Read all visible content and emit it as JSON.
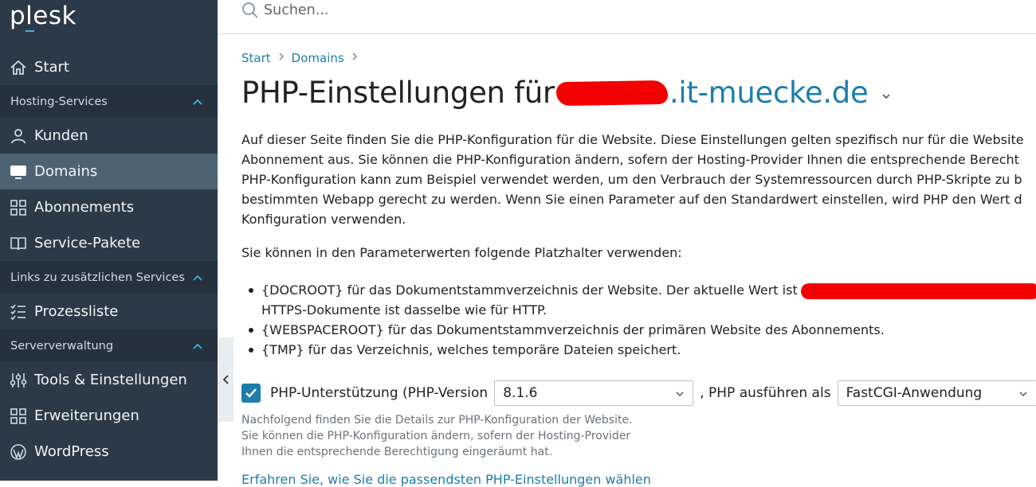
{
  "app": {
    "logo": "plesk"
  },
  "search": {
    "placeholder": "Suchen..."
  },
  "sidebar": {
    "start": "Start",
    "section_hosting": "Hosting-Services",
    "kunden": "Kunden",
    "domains": "Domains",
    "abonnements": "Abonnements",
    "service_pakete": "Service-Pakete",
    "section_links": "Links zu zusätzlichen Services",
    "prozessliste": "Prozessliste",
    "section_server": "Serververwaltung",
    "tools": "Tools & Einstellungen",
    "erweiterungen": "Erweiterungen",
    "wordpress": "WordPress"
  },
  "breadcrumb": {
    "start": "Start",
    "domains": "Domains"
  },
  "page": {
    "title_prefix": "PHP-Einstellungen für",
    "title_domain": ".it-muecke.de"
  },
  "description": {
    "line1": "Auf dieser Seite finden Sie die PHP-Konfiguration für die Website. Diese Einstellungen gelten spezifisch nur für die Website",
    "line2": "Abonnement aus. Sie können die PHP-Konfiguration ändern, sofern der Hosting-Provider Ihnen die entsprechende Berecht",
    "line3": "PHP-Konfiguration kann zum Beispiel verwendet werden, um den Verbrauch der Systemressourcen durch PHP-Skripte zu b",
    "line4": "bestimmten Webapp gerecht zu werden. Wenn Sie einen Parameter auf den Standardwert einstellen, wird PHP den Wert d",
    "line5": "Konfiguration verwenden."
  },
  "placeholders": {
    "intro": "Sie können in den Parameterwerten folgende Platzhalter verwenden:",
    "docroot_a": "{DOCROOT} für das Dokumentstammverzeichnis der Website. Der aktuelle Wert ist",
    "docroot_b": "HTTPS-Dokumente ist dasselbe wie für HTTP.",
    "webspaceroot": "{WEBSPACEROOT} für das Dokumentstammverzeichnis der primären Website des Abonnements.",
    "tmp": "{TMP} für das Verzeichnis, welches temporäre Dateien speichert."
  },
  "php": {
    "support_label": "PHP-Unterstützung (PHP-Version",
    "version": "8.1.6",
    "run_as_label": ", PHP ausführen als",
    "handler": "FastCGI-Anwendung",
    "trailing": ")",
    "checked": true
  },
  "help": {
    "line1": "Nachfolgend finden Sie die Details zur PHP-Konfiguration der Website.",
    "line2": "Sie können die PHP-Konfiguration ändern, sofern der Hosting-Provider",
    "line3": "Ihnen die entsprechende Berechtigung eingeräumt hat."
  },
  "learn_more": "Erfahren Sie, wie Sie die passendsten PHP-Einstellungen wählen",
  "colors": {
    "sidebar": "#2c3a47",
    "section": "#25323e",
    "active": "#4d6272",
    "link": "#1d7eab",
    "redact": "#f30000"
  }
}
